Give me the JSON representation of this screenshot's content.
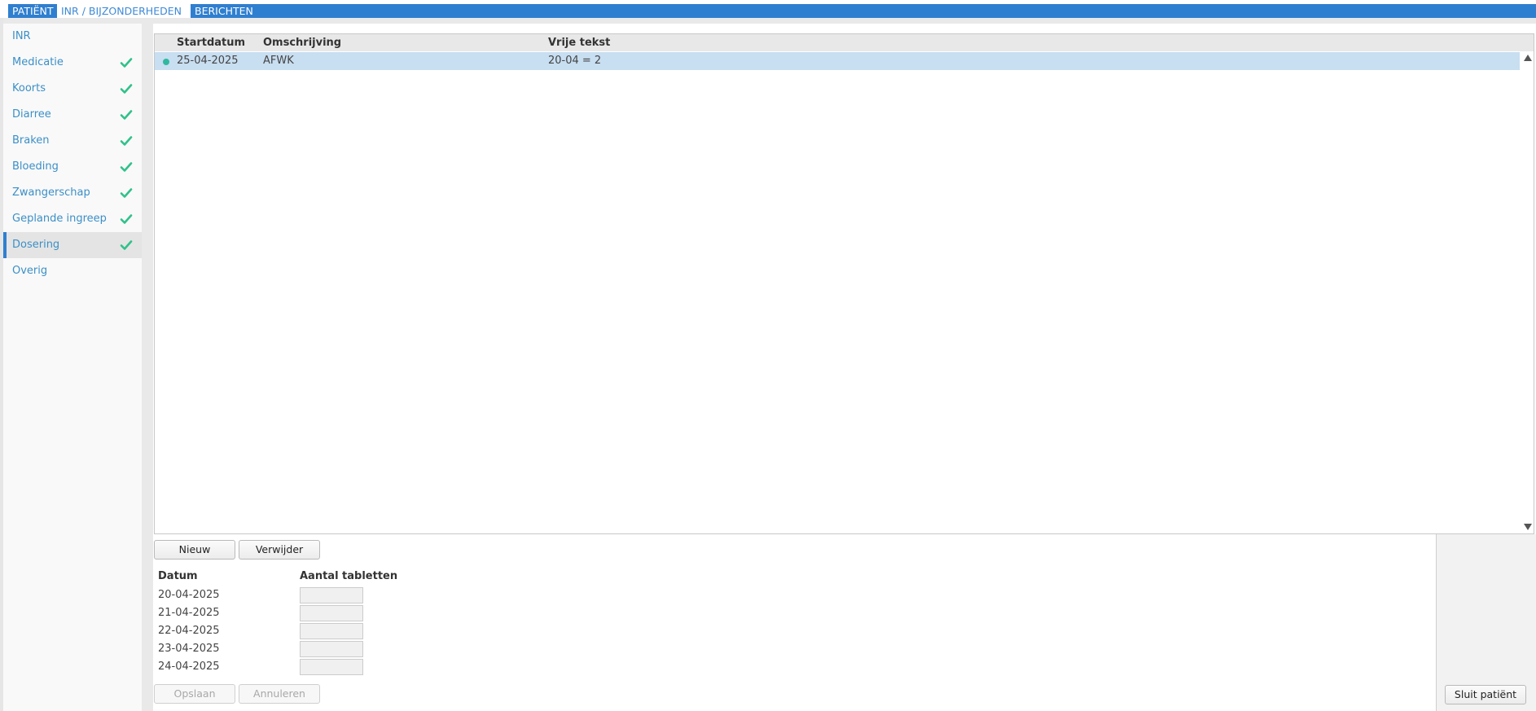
{
  "tabs": [
    {
      "label": "PATIËNT"
    },
    {
      "label": "INR / BIJZONDERHEDEN"
    },
    {
      "label": "BERICHTEN"
    }
  ],
  "active_tab": "INR / BIJZONDERHEDEN",
  "sidebar": {
    "items": [
      {
        "label": "INR",
        "checked": false
      },
      {
        "label": "Medicatie",
        "checked": true
      },
      {
        "label": "Koorts",
        "checked": true
      },
      {
        "label": "Diarree",
        "checked": true
      },
      {
        "label": "Braken",
        "checked": true
      },
      {
        "label": "Bloeding",
        "checked": true
      },
      {
        "label": "Zwangerschap",
        "checked": true
      },
      {
        "label": "Geplande ingreep",
        "checked": true
      },
      {
        "label": "Dosering",
        "checked": true
      },
      {
        "label": "Overig",
        "checked": false
      }
    ],
    "active": "Dosering"
  },
  "grid": {
    "columns": [
      "Startdatum",
      "Omschrijving",
      "Vrije tekst"
    ],
    "rows": [
      {
        "startdatum": "25-04-2025",
        "omschrijving": "AFWK",
        "vrije_tekst": "20-04 = 2"
      }
    ]
  },
  "buttons": {
    "new": "Nieuw",
    "delete": "Verwijder",
    "save": "Opslaan",
    "cancel": "Annuleren",
    "close_patient": "Sluit patiënt"
  },
  "dosage": {
    "headers": [
      "Datum",
      "Aantal tabletten"
    ],
    "rows": [
      {
        "date": "20-04-2025",
        "tablets": ""
      },
      {
        "date": "21-04-2025",
        "tablets": ""
      },
      {
        "date": "22-04-2025",
        "tablets": ""
      },
      {
        "date": "23-04-2025",
        "tablets": ""
      },
      {
        "date": "24-04-2025",
        "tablets": ""
      }
    ]
  },
  "colors": {
    "accent": "#2f7fd0",
    "link": "#3b8fc7",
    "check": "#2fc18a",
    "row_selected": "#c8def1",
    "status_dot": "#2fb8a0"
  },
  "icons": {
    "check": "check-icon",
    "status": "status-dot-icon",
    "scroll_up": "scroll-up-arrow-icon",
    "scroll_down": "scroll-down-arrow-icon"
  }
}
